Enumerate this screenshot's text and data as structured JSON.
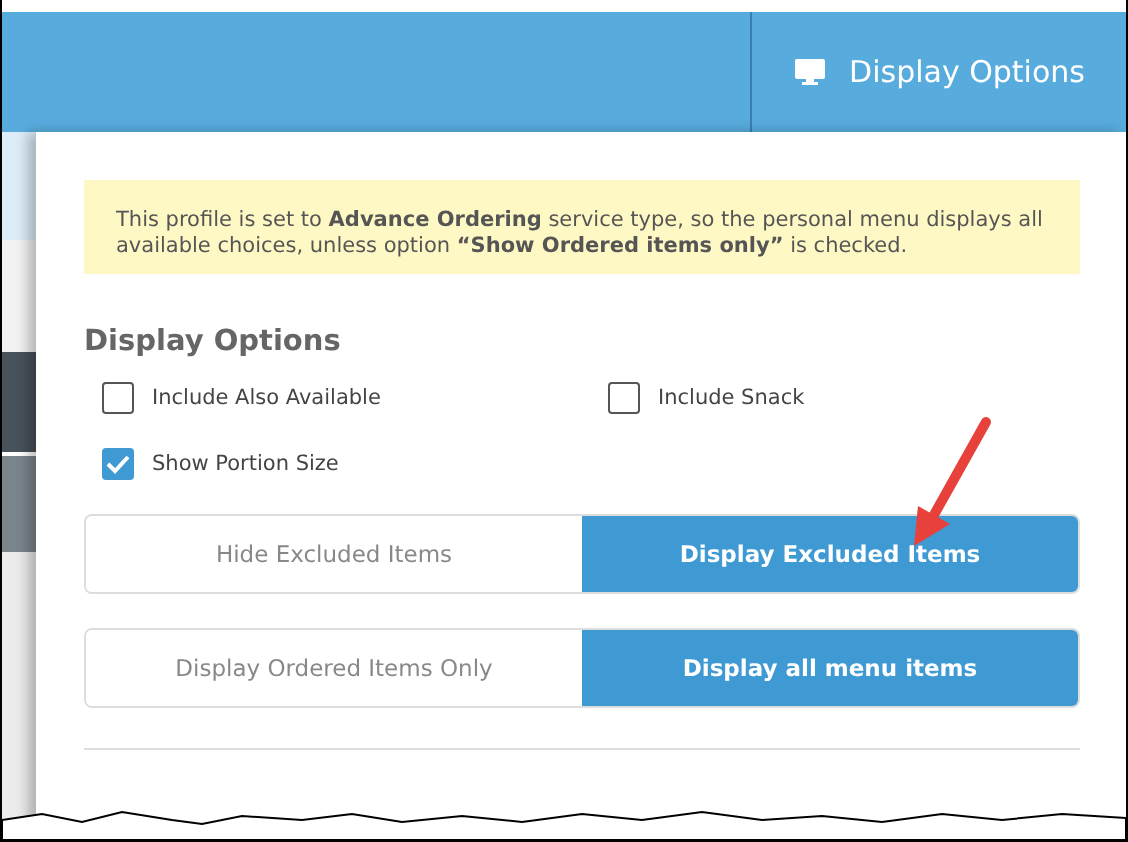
{
  "top_bar": {
    "button": {
      "label": "Display Options"
    }
  },
  "notice": "This profile is set to **Advance Ordering** service type, so the personal menu displays all available choices, unless option **“Show Ordered items only”** is checked.",
  "section_title": "Display Options",
  "checkboxes": [
    {
      "label": "Include Also Available",
      "checked": false
    },
    {
      "label": "Include Snack",
      "checked": false
    },
    {
      "label": "Show Portion Size",
      "checked": true
    }
  ],
  "toggle_groups": [
    {
      "options": [
        {
          "label": "Hide Excluded Items",
          "selected": false
        },
        {
          "label": "Display Excluded Items",
          "selected": true
        }
      ]
    },
    {
      "options": [
        {
          "label": "Display Ordered Items Only",
          "selected": false
        },
        {
          "label": "Display all menu items",
          "selected": true
        }
      ]
    }
  ]
}
